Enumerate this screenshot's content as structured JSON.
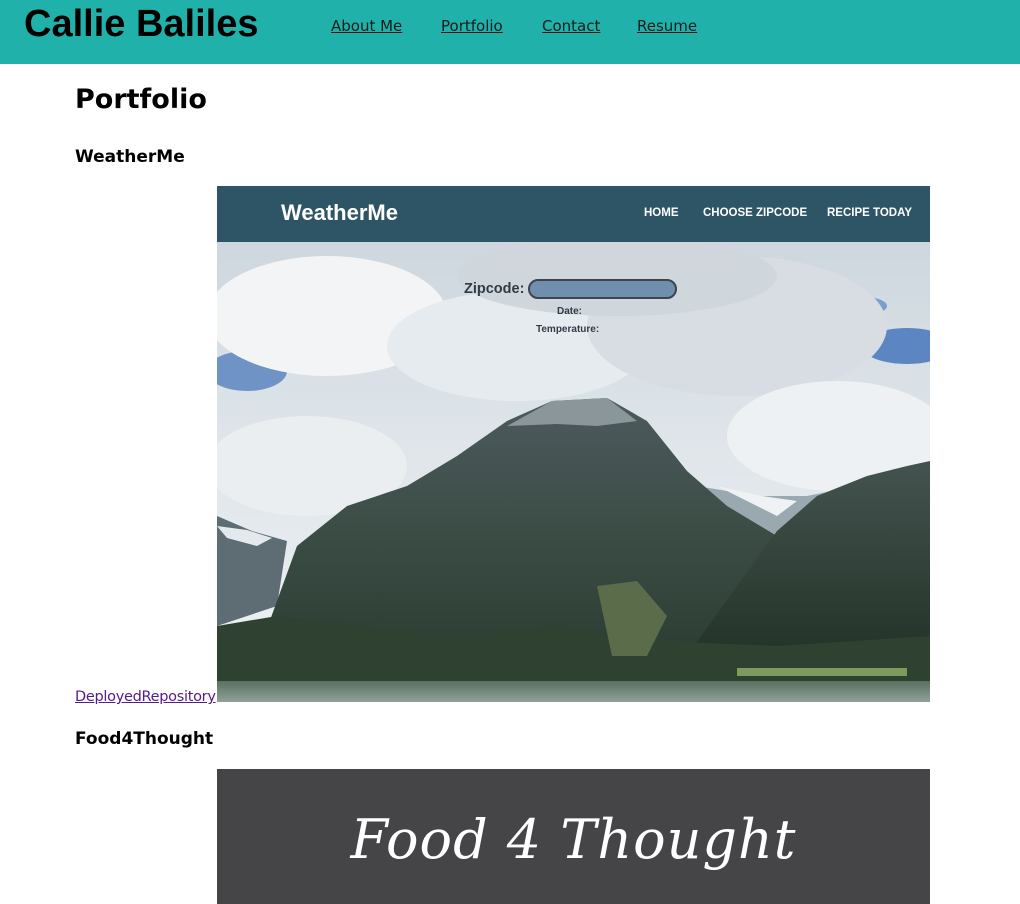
{
  "header": {
    "site_title": "Callie Baliles",
    "nav": [
      {
        "label": "About Me"
      },
      {
        "label": "Portfolio"
      },
      {
        "label": "Contact"
      },
      {
        "label": "Resume"
      }
    ]
  },
  "main": {
    "page_title": "Portfolio",
    "projects": [
      {
        "title": "WeatherMe",
        "links": {
          "deployed": "Deployed",
          "repository": "Repository"
        },
        "screenshot": {
          "brand": "WeatherMe",
          "nav": [
            "HOME",
            "CHOOSE ZIPCODE",
            "RECIPE TODAY"
          ],
          "zip_label": "Zipcode:",
          "date_label": "Date:",
          "temperature_label": "Temperature:"
        }
      },
      {
        "title": "Food4Thought",
        "screenshot": {
          "logo_text": "Food 4 Thought"
        }
      }
    ]
  },
  "colors": {
    "header_bg": "#20b2aa",
    "weatherme_nav_bg": "#2e5566",
    "visited_link": "#551a8b",
    "food4thought_bg": "#454548"
  }
}
